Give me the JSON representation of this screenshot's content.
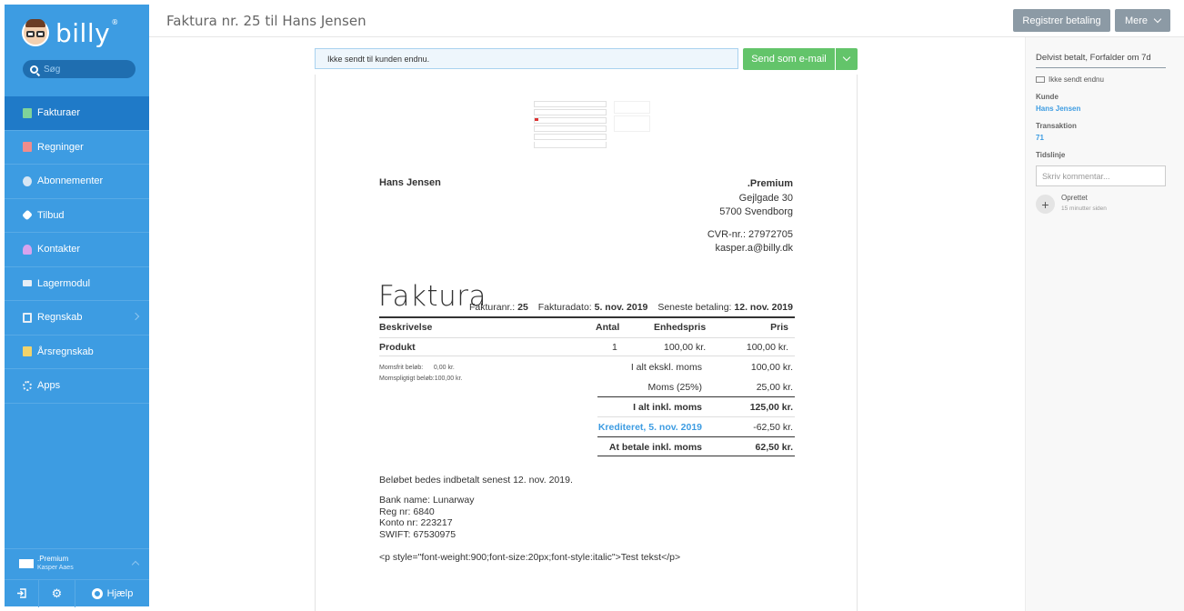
{
  "app": {
    "logo_text": "billy",
    "logo_mark": "®"
  },
  "search": {
    "placeholder": "Søg"
  },
  "sidebar": {
    "items": [
      {
        "label": "Fakturaer",
        "icon": "invoice-icon",
        "color": "#7fd39a"
      },
      {
        "label": "Regninger",
        "icon": "bill-icon",
        "color": "#f08c8c"
      },
      {
        "label": "Abonnementer",
        "icon": "subscription-icon",
        "color": "#d6e6f4"
      },
      {
        "label": "Tilbud",
        "icon": "offer-icon",
        "color": "#ffffff"
      },
      {
        "label": "Kontakter",
        "icon": "contacts-icon",
        "color": "#d7a3ee"
      },
      {
        "label": "Lagermodul",
        "icon": "inventory-icon",
        "color": "#e6eef6"
      },
      {
        "label": "Regnskab",
        "icon": "accounting-icon",
        "color": "#e6eef6"
      },
      {
        "label": "Årsregnskab",
        "icon": "annual-report-icon",
        "color": "#f2d36b"
      },
      {
        "label": "Apps",
        "icon": "apps-icon",
        "color": "#e6eef6"
      }
    ],
    "org_name": ".Premium",
    "org_user": "Kasper Aaes",
    "help_label": "Hjælp"
  },
  "header": {
    "title": "Faktura nr. 25 til Hans Jensen",
    "register_payment": "Registrer betaling",
    "more": "Mere"
  },
  "status": {
    "message": "Ikke sendt til kunden endnu.",
    "send_button": "Send som e-mail"
  },
  "invoice": {
    "customer": "Hans Jensen",
    "sender_name": ".Premium",
    "sender_street": "Gejlgade 30",
    "sender_city": "5700 Svendborg",
    "sender_cvr": "CVR-nr.: 27972705",
    "sender_email": "kasper.a@billy.dk",
    "title": "Faktura",
    "number_label": "Fakturanr.:",
    "number": "25",
    "date_label": "Fakturadato:",
    "date": "5. nov. 2019",
    "due_label": "Seneste betaling:",
    "due": "12. nov. 2019",
    "columns": {
      "description": "Beskrivelse",
      "quantity": "Antal",
      "unit_price": "Enhedspris",
      "price": "Pris"
    },
    "line": {
      "description": "Produkt",
      "quantity": "1",
      "unit_price": "100,00 kr.",
      "price": "100,00 kr."
    },
    "vat_free_label": "Momsfrit beløb:",
    "vat_free_value": "0,00 kr.",
    "vat_liable_label": "Momspligtigt beløb:",
    "vat_liable_value": "100,00 kr.",
    "totals": {
      "excl_label": "I alt ekskl. moms",
      "excl_value": "100,00 kr.",
      "vat_label": "Moms (25%)",
      "vat_value": "25,00 kr.",
      "incl_label": "I alt inkl. moms",
      "incl_value": "125,00 kr.",
      "credit_label": "Krediteret, 5. nov. 2019",
      "credit_value": "-62,50 kr.",
      "due_label": "At betale inkl. moms",
      "due_value": "62,50 kr."
    },
    "payment_note": "Beløbet bedes indbetalt senest 12. nov. 2019.",
    "bank_name": "Bank name: Lunarway",
    "reg_nr": "Reg nr: 6840",
    "konto_nr": "Konto nr: 223217",
    "swift": "SWIFT: 67530975",
    "html_text": "<p style=\"font-weight:900;font-size:20px;font-style:italic\">Test tekst</p>"
  },
  "right_panel": {
    "status": "Delvist betalt, Forfalder om 7d",
    "sent_status": "Ikke sendt endnu",
    "customer_label": "Kunde",
    "customer_value": "Hans Jensen",
    "transaction_label": "Transaktion",
    "transaction_value": "71",
    "timeline_label": "Tidslinje",
    "comment_placeholder": "Skriv kommentar...",
    "event_title": "Oprettet",
    "event_time": "15 minutter siden"
  }
}
